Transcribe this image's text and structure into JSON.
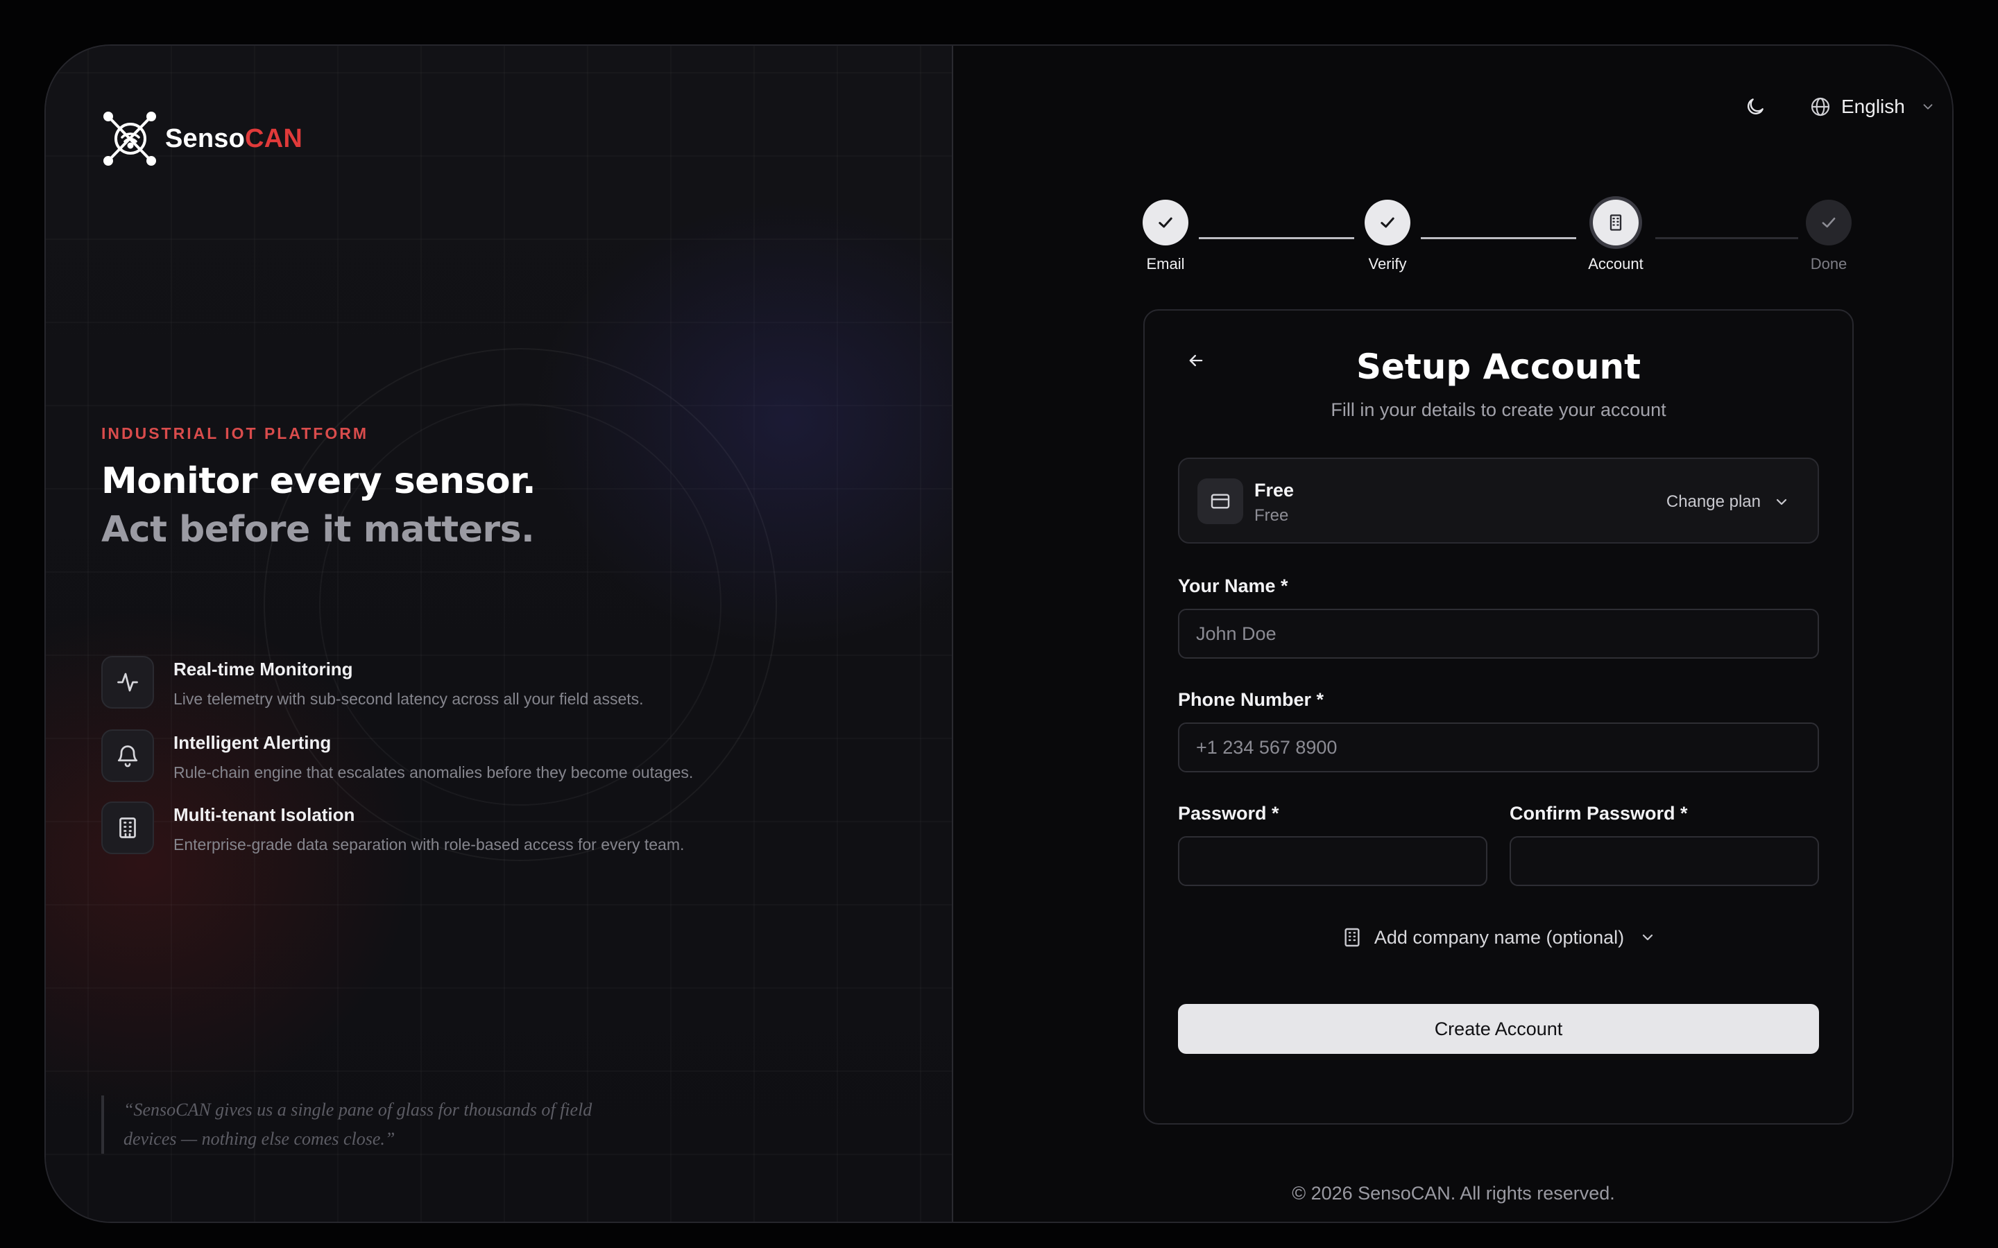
{
  "brand": {
    "name_part1": "Senso",
    "name_part2": "CAN",
    "accent_color": "#e03a3a"
  },
  "hero": {
    "eyebrow": "INDUSTRIAL IOT PLATFORM",
    "headline_line1": "Monitor every sensor.",
    "headline_line2": "Act before it matters."
  },
  "features": [
    {
      "icon": "activity-icon",
      "title": "Real-time Monitoring",
      "description": "Live telemetry with sub-second latency across all your field assets."
    },
    {
      "icon": "bell-icon",
      "title": "Intelligent Alerting",
      "description": "Rule-chain engine that escalates anomalies before they become outages."
    },
    {
      "icon": "building-icon",
      "title": "Multi-tenant Isolation",
      "description": "Enterprise-grade data separation with role-based access for every team."
    }
  ],
  "testimonial": {
    "line1": "“SensoCAN gives us a single pane of glass for thousands of field",
    "line2": "devices — nothing else comes close.”"
  },
  "topbar": {
    "theme_icon": "moon-icon",
    "language_icon": "globe-icon",
    "language": "English"
  },
  "stepper": {
    "steps": [
      {
        "label": "Email",
        "state": "done"
      },
      {
        "label": "Verify",
        "state": "done"
      },
      {
        "label": "Account",
        "state": "current"
      },
      {
        "label": "Done",
        "state": "todo"
      }
    ]
  },
  "form": {
    "title": "Setup Account",
    "subtitle": "Fill in your details to create your account",
    "plan": {
      "name": "Free",
      "tier": "Free",
      "change_label": "Change plan"
    },
    "name": {
      "label": "Your Name *",
      "placeholder": "John Doe",
      "value": ""
    },
    "phone": {
      "label": "Phone Number *",
      "placeholder": "+1 234 567 8900",
      "value": ""
    },
    "password": {
      "label": "Password *",
      "value": ""
    },
    "confirm_password": {
      "label": "Confirm Password *",
      "value": ""
    },
    "company_toggle": "Add company name (optional)",
    "submit": "Create Account"
  },
  "footer": {
    "copyright": "© 2026 SensoCAN. All rights reserved."
  }
}
